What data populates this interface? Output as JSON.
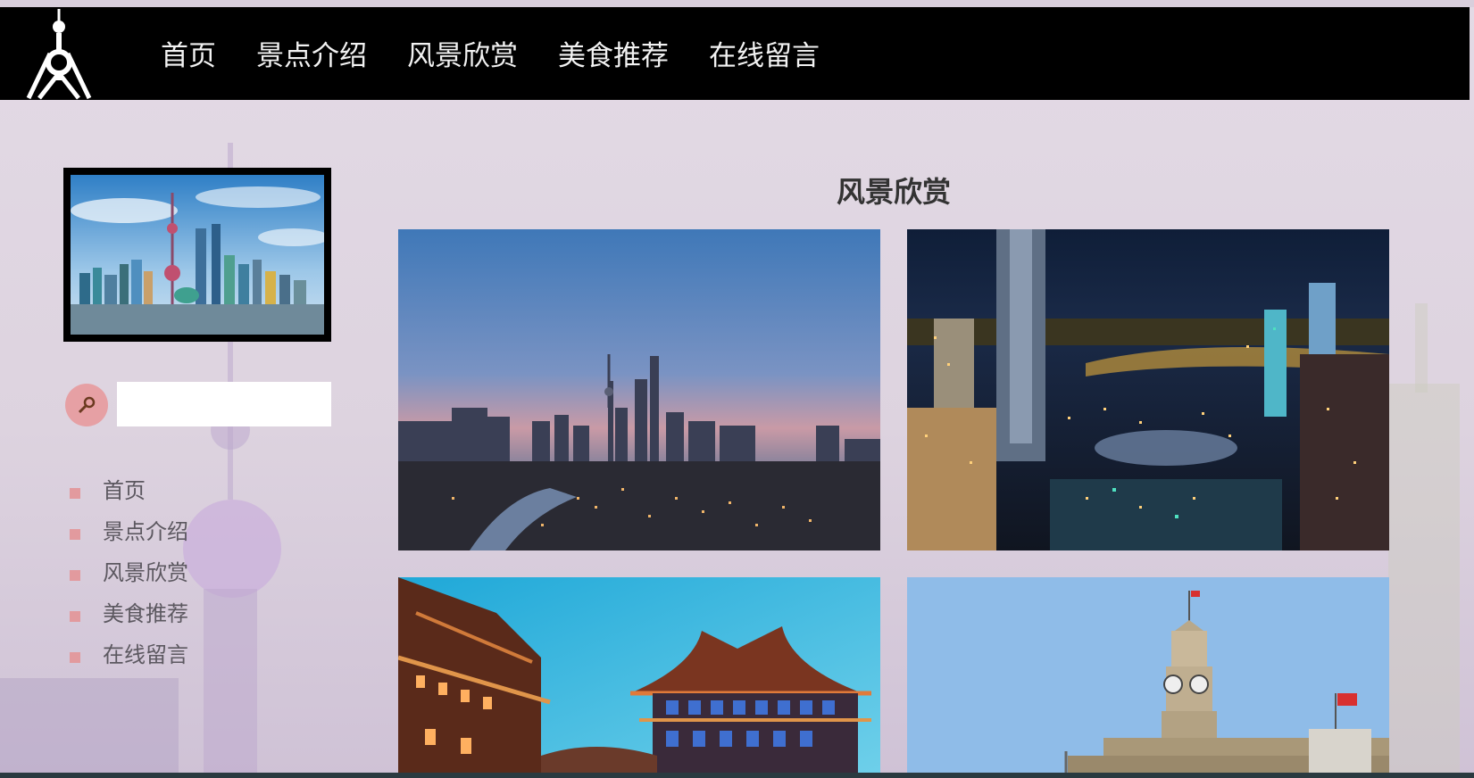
{
  "nav": {
    "items": [
      {
        "label": "首页"
      },
      {
        "label": "景点介绍"
      },
      {
        "label": "风景欣赏"
      },
      {
        "label": "美食推荐"
      },
      {
        "label": "在线留言"
      }
    ]
  },
  "sidebar": {
    "search": {
      "value": "",
      "placeholder": ""
    },
    "menu": [
      {
        "label": "首页"
      },
      {
        "label": "景点介绍"
      },
      {
        "label": "风景欣赏"
      },
      {
        "label": "美食推荐"
      },
      {
        "label": "在线留言"
      }
    ]
  },
  "main": {
    "title": "风景欣赏"
  },
  "colors": {
    "navbar": "#000000",
    "accent": "#e29a9e",
    "background": "#ddd4e0"
  },
  "icons": {
    "logo": "oriental-pearl-tower-logo",
    "search": "search-icon"
  }
}
